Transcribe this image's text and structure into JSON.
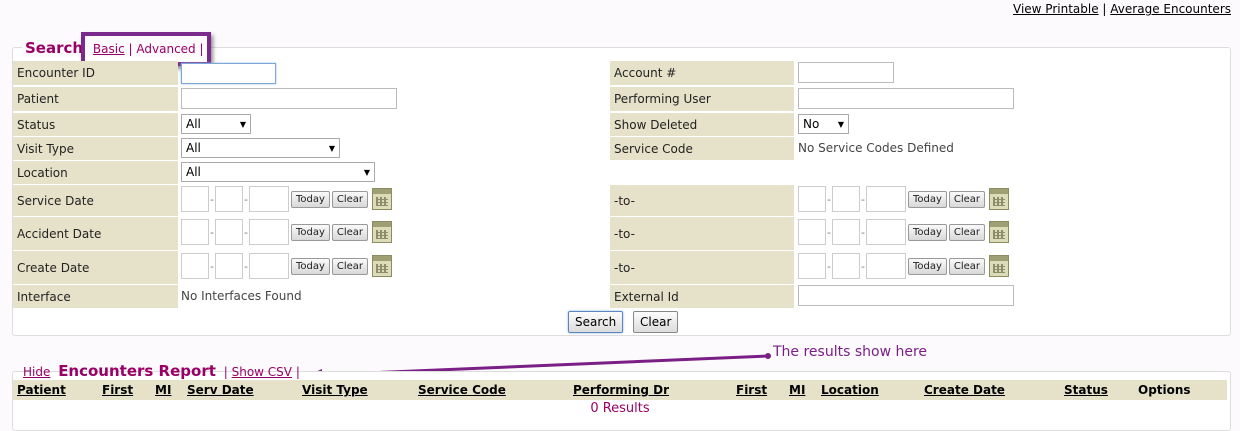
{
  "top_links": {
    "view_printable": "View Printable",
    "separator": "|",
    "average_encounters": "Average Encounters"
  },
  "search": {
    "title": "Search",
    "basic": "Basic",
    "advanced": "Advanced",
    "sep": "|",
    "fields": {
      "encounter_id": "Encounter ID",
      "account": "Account #",
      "patient": "Patient",
      "performing_user": "Performing User",
      "status": "Status",
      "status_value": "All",
      "show_deleted": "Show Deleted",
      "show_deleted_value": "No",
      "visit_type": "Visit Type",
      "visit_type_value": "All",
      "service_code": "Service Code",
      "service_code_value": "No Service Codes Defined",
      "location": "Location",
      "location_value": "All",
      "service_date": "Service Date",
      "accident_date": "Accident Date",
      "create_date": "Create Date",
      "to": "-to-",
      "interface": "Interface",
      "interface_value": "No Interfaces Found",
      "external_id": "External Id"
    },
    "date_sep": "-",
    "today": "Today",
    "clear": "Clear",
    "search_button": "Search",
    "clear_button": "Clear"
  },
  "annotation": {
    "text": "The results show here"
  },
  "report": {
    "hide": "Hide",
    "title": "Encounters Report",
    "sep": "|",
    "show_csv": "Show CSV",
    "sep2": "|",
    "columns": [
      "Patient",
      "First",
      "MI",
      "Serv Date",
      "Visit Type",
      "Service Code",
      "Performing Dr",
      "First",
      "MI",
      "Location",
      "Create Date",
      "Status",
      "Options"
    ],
    "results_text": "0 Results"
  },
  "colors": {
    "accent": "#990066",
    "label_bg": "#e6e2c9",
    "annotation": "#7a1f86"
  }
}
